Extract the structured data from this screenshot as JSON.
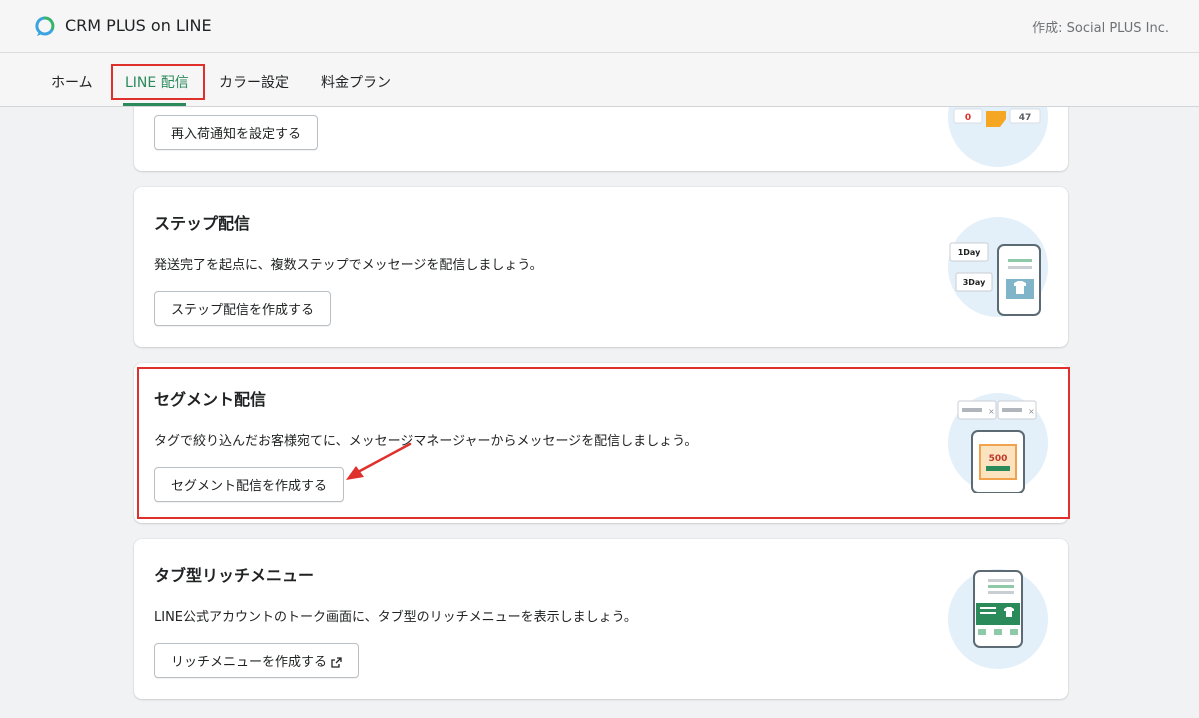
{
  "header": {
    "app_title": "CRM PLUS on LINE",
    "author": "作成: Social PLUS Inc."
  },
  "nav": {
    "tabs": [
      {
        "label": "ホーム"
      },
      {
        "label": "LINE 配信",
        "active": true
      },
      {
        "label": "カラー設定"
      },
      {
        "label": "料金プラン"
      }
    ]
  },
  "cards": {
    "restock": {
      "button": "再入荷通知を設定する",
      "illustration_texts": [
        "0",
        "47"
      ]
    },
    "step": {
      "title": "ステップ配信",
      "description": "発送完了を起点に、複数ステップでメッセージを配信しましょう。",
      "button": "ステップ配信を作成する",
      "illustration_texts": [
        "1Day",
        "3Day"
      ]
    },
    "segment": {
      "title": "セグメント配信",
      "description": "タグで絞り込んだお客様宛てに、メッセージマネージャーからメッセージを配信しましょう。",
      "button": "セグメント配信を作成する",
      "illustration_texts": [
        "500"
      ]
    },
    "rich_menu": {
      "title": "タブ型リッチメニュー",
      "description": "LINE公式アカウントのトーク画面に、タブ型のリッチメニューを表示しましょう。",
      "button": "リッチメニューを作成する"
    }
  },
  "colors": {
    "accent": "#2a8a5a",
    "highlight": "#e0302b",
    "illustration_bg": "#e3f0fa"
  }
}
